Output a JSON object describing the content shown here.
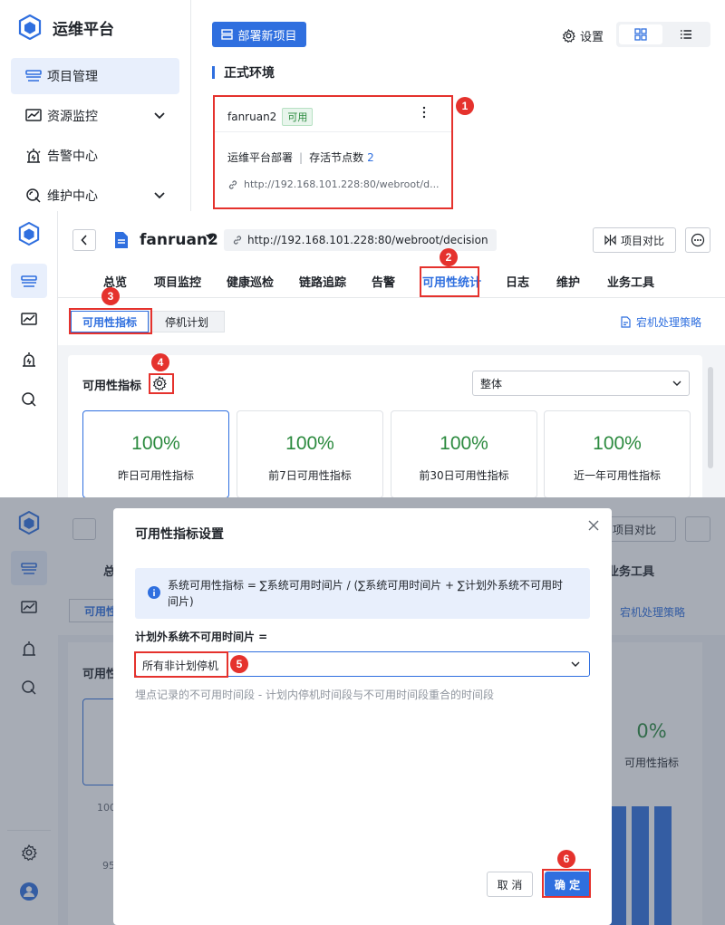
{
  "app": {
    "title": "运维平台"
  },
  "sidebar": {
    "items": [
      {
        "label": "项目管理",
        "active": true
      },
      {
        "label": "资源监控"
      },
      {
        "label": "告警中心"
      },
      {
        "label": "维护中心"
      }
    ]
  },
  "projects": {
    "deploy_button": "部署新项目",
    "settings_label": "设置",
    "section_title": "正式环境",
    "card": {
      "name": "fanruan2",
      "status": "可用",
      "type": "运维平台部署",
      "nodes_label": "存活节点数",
      "nodes_count": "2",
      "url": "http://192.168.101.228:80/webroot/d..."
    }
  },
  "detail": {
    "project_name": "fanruan2",
    "url": "http://192.168.101.228:80/webroot/decision",
    "compare_button": "项目对比",
    "tabs": [
      "总览",
      "项目监控",
      "健康巡检",
      "链路追踪",
      "告警",
      "可用性统计",
      "日志",
      "维护",
      "业务工具"
    ],
    "active_tab": "可用性统计",
    "subtabs": [
      "可用性指标",
      "停机计划"
    ],
    "policy_link": "宕机处理策略",
    "indicator_title": "可用性指标",
    "scope_select": "整体",
    "cards": [
      {
        "value": "100%",
        "label": "昨日可用性指标"
      },
      {
        "value": "100%",
        "label": "前7日可用性指标"
      },
      {
        "value": "100%",
        "label": "前30日可用性指标"
      },
      {
        "value": "100%",
        "label": "近一年可用性指标"
      }
    ]
  },
  "background": {
    "tab_fragment": "总",
    "tools_tab": "业务工具",
    "compare": "项目对比",
    "policy": "宕机处理策略",
    "subtab": "可用性",
    "title_fragment": "可用性",
    "card_value": "0%",
    "card_label": "可用性指标",
    "axis_100": "100",
    "axis_95": "95"
  },
  "dialog": {
    "title": "可用性指标设置",
    "info": "系统可用性指标 = ∑系统可用时间片 / (∑系统可用时间片 + ∑计划外系统不可用时间片)",
    "field_label": "计划外系统不可用时间片 =",
    "select_value": "所有非计划停机",
    "hint": "埋点记录的不可用时间段 - 计划内停机时间段与不可用时间段重合的时间段",
    "cancel": "取 消",
    "confirm": "确 定"
  },
  "markers": [
    "1",
    "2",
    "3",
    "4",
    "5",
    "6"
  ],
  "colors": {
    "primary": "#2f6fdf",
    "success": "#2b8a3e",
    "annotation": "#e5322d"
  }
}
